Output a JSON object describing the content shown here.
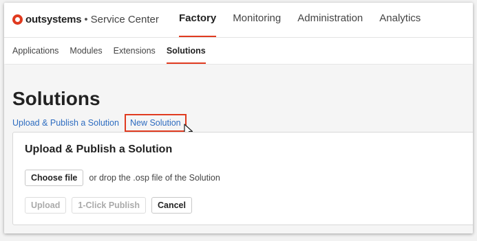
{
  "brand": {
    "name": "outsystems",
    "separator": "•",
    "product": "Service Center",
    "accent": "#e03a1f"
  },
  "main_nav": {
    "tabs": [
      {
        "label": "Factory",
        "active": true
      },
      {
        "label": "Monitoring",
        "active": false
      },
      {
        "label": "Administration",
        "active": false
      },
      {
        "label": "Analytics",
        "active": false
      }
    ]
  },
  "sub_nav": {
    "tabs": [
      {
        "label": "Applications",
        "active": false
      },
      {
        "label": "Modules",
        "active": false
      },
      {
        "label": "Extensions",
        "active": false
      },
      {
        "label": "Solutions",
        "active": true
      }
    ]
  },
  "page": {
    "title": "Solutions",
    "links": {
      "upload_publish": "Upload & Publish a Solution",
      "new_solution": "New Solution"
    }
  },
  "panel": {
    "title": "Upload & Publish a Solution",
    "choose_file_label": "Choose file",
    "drop_text": "or drop the .osp file of the Solution",
    "buttons": {
      "upload": "Upload",
      "one_click_publish": "1-Click Publish",
      "cancel": "Cancel"
    }
  },
  "icons": {
    "logo": "outsystems-logo-icon",
    "cursor": "mouse-pointer-icon"
  },
  "colors": {
    "link": "#2d6cc0",
    "highlight": "#e03a1f"
  }
}
